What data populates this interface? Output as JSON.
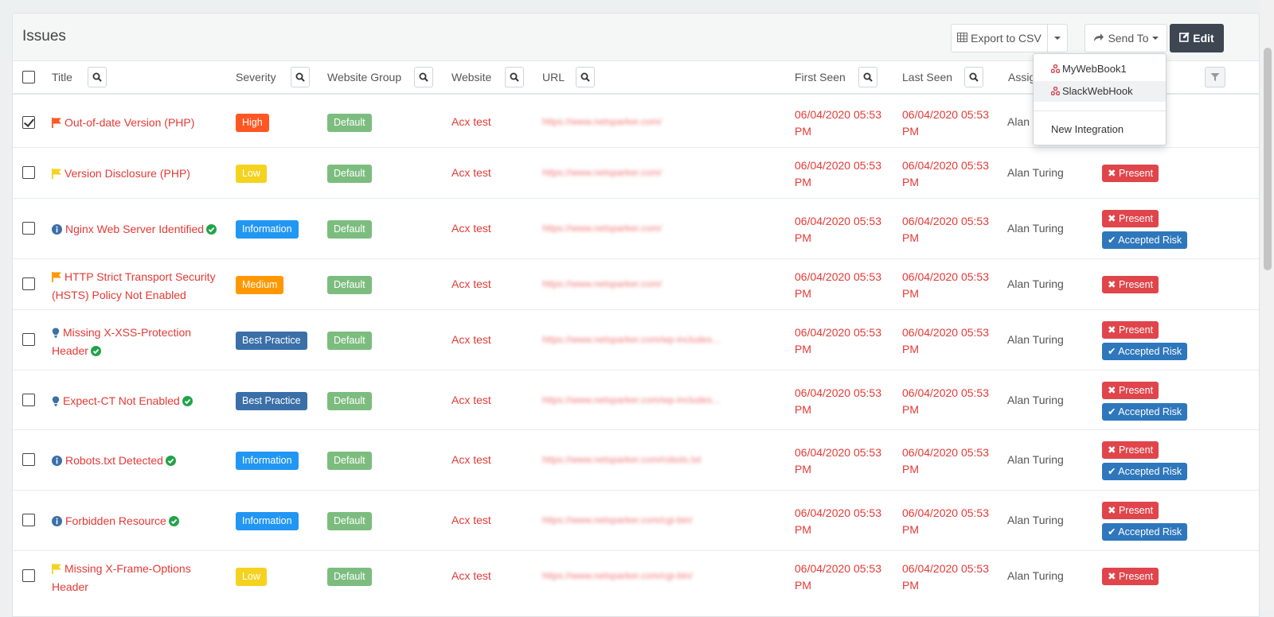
{
  "panel": {
    "title": "Issues",
    "export_label": "Export to CSV",
    "send_to_label": "Send To",
    "edit_label": "Edit"
  },
  "send_to_menu": {
    "items": [
      "MyWebBook1",
      "SlackWebHook"
    ],
    "new_integration": "New Integration"
  },
  "columns": {
    "title": "Title",
    "severity": "Severity",
    "website_group": "Website Group",
    "website": "Website",
    "url": "URL",
    "first_seen": "First Seen",
    "last_seen": "Last Seen",
    "assignee": "Assig"
  },
  "rows": [
    {
      "title": "Out-of-date Version (PHP)",
      "severity": "High",
      "group": "Default",
      "website": "Acx test",
      "url": "https://www.netsparker.com/",
      "first_seen": "06/04/2020 05:53",
      "first_seen_pm": "PM",
      "last_seen": "06/04/2020 05:53",
      "last_seen_pm": "PM",
      "assignee": "Alan T"
    },
    {
      "title": "Version Disclosure (PHP)",
      "severity": "Low",
      "group": "Default",
      "website": "Acx test",
      "url": "https://www.netsparker.com/",
      "first_seen": "06/04/2020 05:53",
      "first_seen_pm": "PM",
      "last_seen": "06/04/2020 05:53",
      "last_seen_pm": "PM",
      "assignee": "Alan Turing",
      "status1": "Present"
    },
    {
      "title": "Nginx Web Server Identified",
      "severity": "Information",
      "group": "Default",
      "website": "Acx test",
      "url": "https://www.netsparker.com/",
      "first_seen": "06/04/2020 05:53",
      "first_seen_pm": "PM",
      "last_seen": "06/04/2020 05:53",
      "last_seen_pm": "PM",
      "assignee": "Alan Turing",
      "status1": "Present",
      "status2": "Accepted Risk"
    },
    {
      "title1": "HTTP Strict Transport Security",
      "title2": "(HSTS) Policy Not Enabled",
      "severity": "Medium",
      "group": "Default",
      "website": "Acx test",
      "url": "https://www.netsparker.com/",
      "first_seen": "06/04/2020 05:53",
      "first_seen_pm": "PM",
      "last_seen": "06/04/2020 05:53",
      "last_seen_pm": "PM",
      "assignee": "Alan Turing",
      "status1": "Present"
    },
    {
      "title1": "Missing X-XSS-Protection",
      "title2": "Header",
      "severity": "Best Practice",
      "group": "Default",
      "website": "Acx test",
      "url": "https://www.netsparker.com/wp-includes...",
      "first_seen": "06/04/2020 05:53",
      "first_seen_pm": "PM",
      "last_seen": "06/04/2020 05:53",
      "last_seen_pm": "PM",
      "assignee": "Alan Turing",
      "status1": "Present",
      "status2": "Accepted Risk"
    },
    {
      "title": "Expect-CT Not Enabled",
      "severity": "Best Practice",
      "group": "Default",
      "website": "Acx test",
      "url": "https://www.netsparker.com/wp-includes...",
      "first_seen": "06/04/2020 05:53",
      "first_seen_pm": "PM",
      "last_seen": "06/04/2020 05:53",
      "last_seen_pm": "PM",
      "assignee": "Alan Turing",
      "status1": "Present",
      "status2": "Accepted Risk"
    },
    {
      "title": "Robots.txt Detected",
      "severity": "Information",
      "group": "Default",
      "website": "Acx test",
      "url": "https://www.netsparker.com/robots.txt",
      "first_seen": "06/04/2020 05:53",
      "first_seen_pm": "PM",
      "last_seen": "06/04/2020 05:53",
      "last_seen_pm": "PM",
      "assignee": "Alan Turing",
      "status1": "Present",
      "status2": "Accepted Risk"
    },
    {
      "title": "Forbidden Resource",
      "severity": "Information",
      "group": "Default",
      "website": "Acx test",
      "url": "https://www.netsparker.com/cgi-bin/",
      "first_seen": "06/04/2020 05:53",
      "first_seen_pm": "PM",
      "last_seen": "06/04/2020 05:53",
      "last_seen_pm": "PM",
      "assignee": "Alan Turing",
      "status1": "Present",
      "status2": "Accepted Risk"
    },
    {
      "title1": "Missing X-Frame-Options",
      "title2": "Header",
      "severity": "Low",
      "group": "Default",
      "website": "Acx test",
      "url": "https://www.netsparker.com/cgi-bin/",
      "first_seen": "06/04/2020 05:53",
      "first_seen_pm": "PM",
      "last_seen": "06/04/2020 05:53",
      "last_seen_pm": "PM",
      "assignee": "Alan Turing",
      "status1": "Present"
    }
  ]
}
